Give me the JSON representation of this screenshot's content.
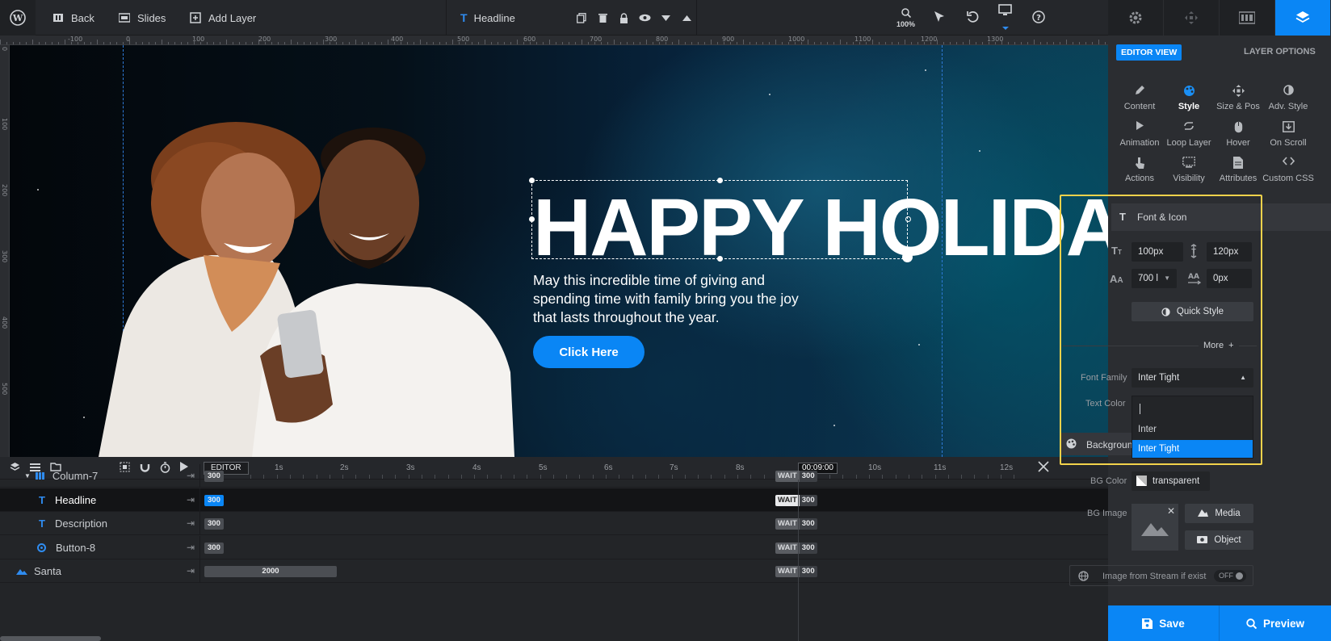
{
  "topbar": {
    "back_label": "Back",
    "slides_label": "Slides",
    "add_layer_label": "Add Layer",
    "selected_layer_label": "Headline",
    "zoom_label": "100%"
  },
  "ruler": {
    "top_ticks": [
      "-100",
      "0",
      "100",
      "200",
      "300",
      "400",
      "500",
      "600",
      "700",
      "800",
      "900",
      "1000",
      "1100",
      "1200",
      "1300"
    ],
    "left_ticks": [
      "0",
      "100",
      "200",
      "300",
      "400",
      "500"
    ]
  },
  "slide": {
    "headline": "HAPPY HOLIDAYS",
    "description": "May this incredible time of giving and spending time with family bring you the joy that lasts throughout the year.",
    "button_label": "Click Here"
  },
  "timeline": {
    "editor_label": "EDITOR",
    "seconds": [
      "1s",
      "2s",
      "3s",
      "4s",
      "5s",
      "6s",
      "7s",
      "8s",
      "00:09:00",
      "10s",
      "11s",
      "12s"
    ],
    "wait_label": "WAIT",
    "rows": [
      {
        "name": "Column-7",
        "start": "300",
        "end": "300"
      },
      {
        "name": "Headline",
        "start": "300",
        "end": "300"
      },
      {
        "name": "Description",
        "start": "300",
        "end": "300"
      },
      {
        "name": "Button-8",
        "start": "300",
        "end": "300"
      },
      {
        "name": "Santa",
        "start": "2000",
        "end": "300"
      }
    ]
  },
  "panel": {
    "editor_view_label": "EDITOR VIEW",
    "layer_options_label": "LAYER OPTIONS",
    "grid": [
      {
        "label": "Content",
        "icon": "pencil-icon"
      },
      {
        "label": "Style",
        "icon": "palette-icon"
      },
      {
        "label": "Size & Pos",
        "icon": "move-icon"
      },
      {
        "label": "Adv. Style",
        "icon": "contrast-icon"
      },
      {
        "label": "Animation",
        "icon": "play-icon"
      },
      {
        "label": "Loop Layer",
        "icon": "loop-icon"
      },
      {
        "label": "Hover",
        "icon": "mouse-icon"
      },
      {
        "label": "On Scroll",
        "icon": "scroll-icon"
      },
      {
        "label": "Actions",
        "icon": "pointer-icon"
      },
      {
        "label": "Visibility",
        "icon": "visibility-icon"
      },
      {
        "label": "Attributes",
        "icon": "document-icon"
      },
      {
        "label": "Custom CSS",
        "icon": "code-icon"
      }
    ],
    "font_section_title": "Font & Icon",
    "font_size": "100px",
    "line_height": "120px",
    "font_weight": "700 l",
    "letter_spacing": "0px",
    "quick_style_label": "Quick Style",
    "more_label": "More",
    "font_family_label": "Font Family",
    "font_family_value": "Inter Tight",
    "text_color_label": "Text Color",
    "font_options": [
      "Inter",
      "Inter Tight"
    ],
    "background_section_title": "Backgroun",
    "bg_color_label": "BG Color",
    "bg_color_value": "transparent",
    "bg_image_label": "BG Image",
    "media_label": "Media",
    "object_label": "Object",
    "stream_label": "Image from Stream if exist",
    "stream_toggle": "OFF",
    "save_label": "Save",
    "preview_label": "Preview"
  },
  "colors": {
    "accent": "#0a86f5",
    "highlight_outline": "#f2d24b"
  }
}
